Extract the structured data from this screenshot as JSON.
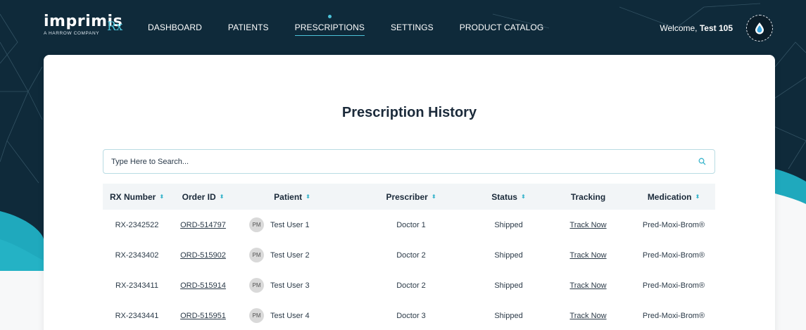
{
  "header": {
    "logo_text": "imprimis",
    "logo_rx": "Rx",
    "logo_sub": "A HARROW COMPANY",
    "nav": [
      {
        "label": "DASHBOARD"
      },
      {
        "label": "PATIENTS"
      },
      {
        "label": "PRESCRIPTIONS",
        "active": true
      },
      {
        "label": "SETTINGS"
      },
      {
        "label": "PRODUCT CATALOG"
      }
    ],
    "welcome_prefix": "Welcome,",
    "user_name": "Test 105"
  },
  "main": {
    "title": "Prescription History",
    "search": {
      "placeholder": "Type Here to Search...",
      "value": ""
    },
    "columns": [
      {
        "label": "RX Number",
        "sortable": true
      },
      {
        "label": "Order ID",
        "sortable": true
      },
      {
        "label": "Patient",
        "sortable": true
      },
      {
        "label": "Prescriber",
        "sortable": true
      },
      {
        "label": "Status",
        "sortable": true
      },
      {
        "label": "Tracking",
        "sortable": false
      },
      {
        "label": "Medication",
        "sortable": true
      }
    ],
    "rows": [
      {
        "rx": "RX-2342522",
        "order": "ORD-514797",
        "initials": "PM",
        "patient": "Test User 1",
        "prescriber": "Doctor 1",
        "status": "Shipped",
        "tracking": "Track Now",
        "medication": "Pred-Moxi-Brom®"
      },
      {
        "rx": "RX-2343402",
        "order": "ORD-515902",
        "initials": "PM",
        "patient": "Test User 2",
        "prescriber": "Doctor 2",
        "status": "Shipped",
        "tracking": "Track Now",
        "medication": "Pred-Moxi-Brom®"
      },
      {
        "rx": "RX-2343411",
        "order": "ORD-515914",
        "initials": "PM",
        "patient": "Test User 3",
        "prescriber": "Doctor 2",
        "status": "Shipped",
        "tracking": "Track Now",
        "medication": "Pred-Moxi-Brom®"
      },
      {
        "rx": "RX-2343441",
        "order": "ORD-515951",
        "initials": "PM",
        "patient": "Test User 4",
        "prescriber": "Doctor 3",
        "status": "Shipped",
        "tracking": "Track Now",
        "medication": "Pred-Moxi-Brom®"
      }
    ]
  },
  "colors": {
    "header_bg": "#0f2a3a",
    "accent": "#4cc3d9",
    "sort_icon": "#3bb5cc",
    "card_bg": "#ffffff"
  },
  "icons": {
    "sort": "sort-arrows-icon",
    "search": "search-icon",
    "avatar": "drop-icon"
  }
}
